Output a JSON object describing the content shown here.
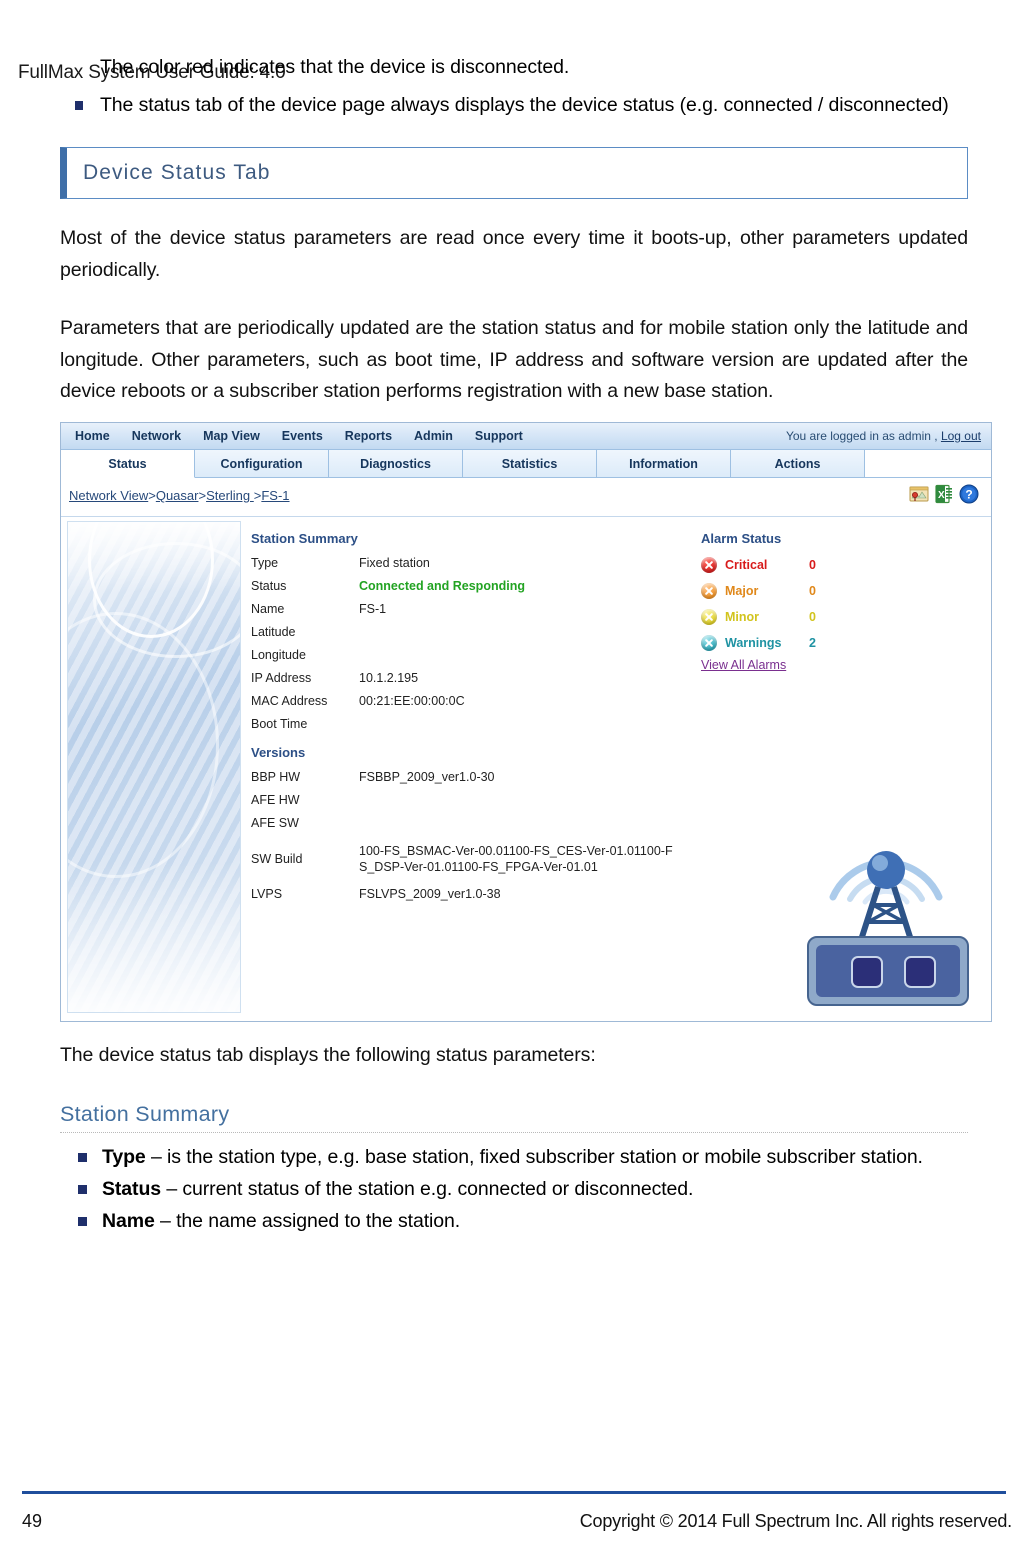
{
  "document": {
    "running_header": "FullMax System User Guide: 4.0",
    "page_number": "49",
    "copyright": "Copyright © 2014 Full Spectrum Inc. All rights reserved."
  },
  "intro_bullets": [
    {
      "text": "The color red indicates that the device is disconnected.",
      "bullet": false
    },
    {
      "text": "The status tab of the device page always displays the device status (e.g. connected / disconnected)",
      "bullet": true
    }
  ],
  "heading": {
    "title": "Device Status Tab"
  },
  "paragraphs": {
    "p1": "Most of the device status parameters are read once every time it boots-up, other parameters updated periodically.",
    "p2": "Parameters that are periodically updated are the station status and for mobile station only the latitude and longitude. Other parameters, such as boot time, IP address and software version are updated after the device reboots or a subscriber station performs registration with a new base station.",
    "p3": "The device status tab displays the following status parameters:"
  },
  "subheading": {
    "title": "Station Summary"
  },
  "definitions": [
    {
      "term": "Type",
      "desc": " – is the station type, e.g. base station, fixed subscriber station or mobile subscriber station."
    },
    {
      "term": "Status",
      "desc": " – current status of the station e.g. connected or disconnected."
    },
    {
      "term": "Name",
      "desc": " – the name assigned to the station."
    }
  ],
  "screenshot": {
    "nav_items": [
      "Home",
      "Network",
      "Map View",
      "Events",
      "Reports",
      "Admin",
      "Support"
    ],
    "login_text": "You are logged in as admin ,",
    "logout_label": "Log out",
    "tabs": [
      {
        "label": "Status",
        "active": true
      },
      {
        "label": "Configuration",
        "active": false
      },
      {
        "label": "Diagnostics",
        "active": false
      },
      {
        "label": "Statistics",
        "active": false
      },
      {
        "label": "Information",
        "active": false
      },
      {
        "label": "Actions",
        "active": false
      }
    ],
    "breadcrumb": {
      "parts": [
        "Network View",
        "Quasar",
        "Sterling ",
        "FS-1"
      ],
      "separator": ">",
      "full": "Network View>Quasar>Sterling >FS-1"
    },
    "toolbar_icons": [
      "map-pin-icon",
      "excel-export-icon",
      "help-icon"
    ],
    "station_summary": {
      "title": "Station Summary",
      "rows": [
        {
          "label": "Type",
          "value": "Fixed station",
          "style": "normal"
        },
        {
          "label": "Status",
          "value": "Connected and Responding",
          "style": "green"
        },
        {
          "label": "Name",
          "value": "FS-1",
          "style": "normal"
        },
        {
          "label": "Latitude",
          "value": "",
          "style": "normal"
        },
        {
          "label": "Longitude",
          "value": "",
          "style": "normal"
        },
        {
          "label": "IP Address",
          "value": "10.1.2.195",
          "style": "normal"
        },
        {
          "label": "MAC Address",
          "value": "00:21:EE:00:00:0C",
          "style": "normal"
        },
        {
          "label": "Boot Time",
          "value": "",
          "style": "normal"
        }
      ]
    },
    "versions": {
      "title": "Versions",
      "rows": [
        {
          "label": "BBP HW",
          "value": "FSBBP_2009_ver1.0-30"
        },
        {
          "label": "AFE HW",
          "value": ""
        },
        {
          "label": "AFE SW",
          "value": ""
        },
        {
          "label": "SW Build",
          "value": "100-FS_BSMAC-Ver-00.01100-FS_CES-Ver-01.01100-FS_DSP-Ver-01.01100-FS_FPGA-Ver-01.01"
        },
        {
          "label": "LVPS",
          "value": "FSLVPS_2009_ver1.0-38"
        }
      ]
    },
    "alarm_status": {
      "title": "Alarm Status",
      "rows": [
        {
          "label": "Critical",
          "count": "0",
          "color": "#d81b1b"
        },
        {
          "label": "Major",
          "count": "0",
          "color": "#f09020"
        },
        {
          "label": "Minor",
          "count": "0",
          "color": "#e0d022"
        },
        {
          "label": "Warnings",
          "count": "2",
          "color": "#2aa8b8"
        }
      ],
      "link_label": "View All Alarms"
    }
  },
  "colors": {
    "heading_border": "#3f6fa8",
    "heading_text": "#3d5a80",
    "subheading_text": "#44709f",
    "bullet": "#1f2f6b",
    "footer_rule": "#1f4e9c",
    "status_green": "#22a322",
    "link_purple": "#7a2f8f"
  }
}
